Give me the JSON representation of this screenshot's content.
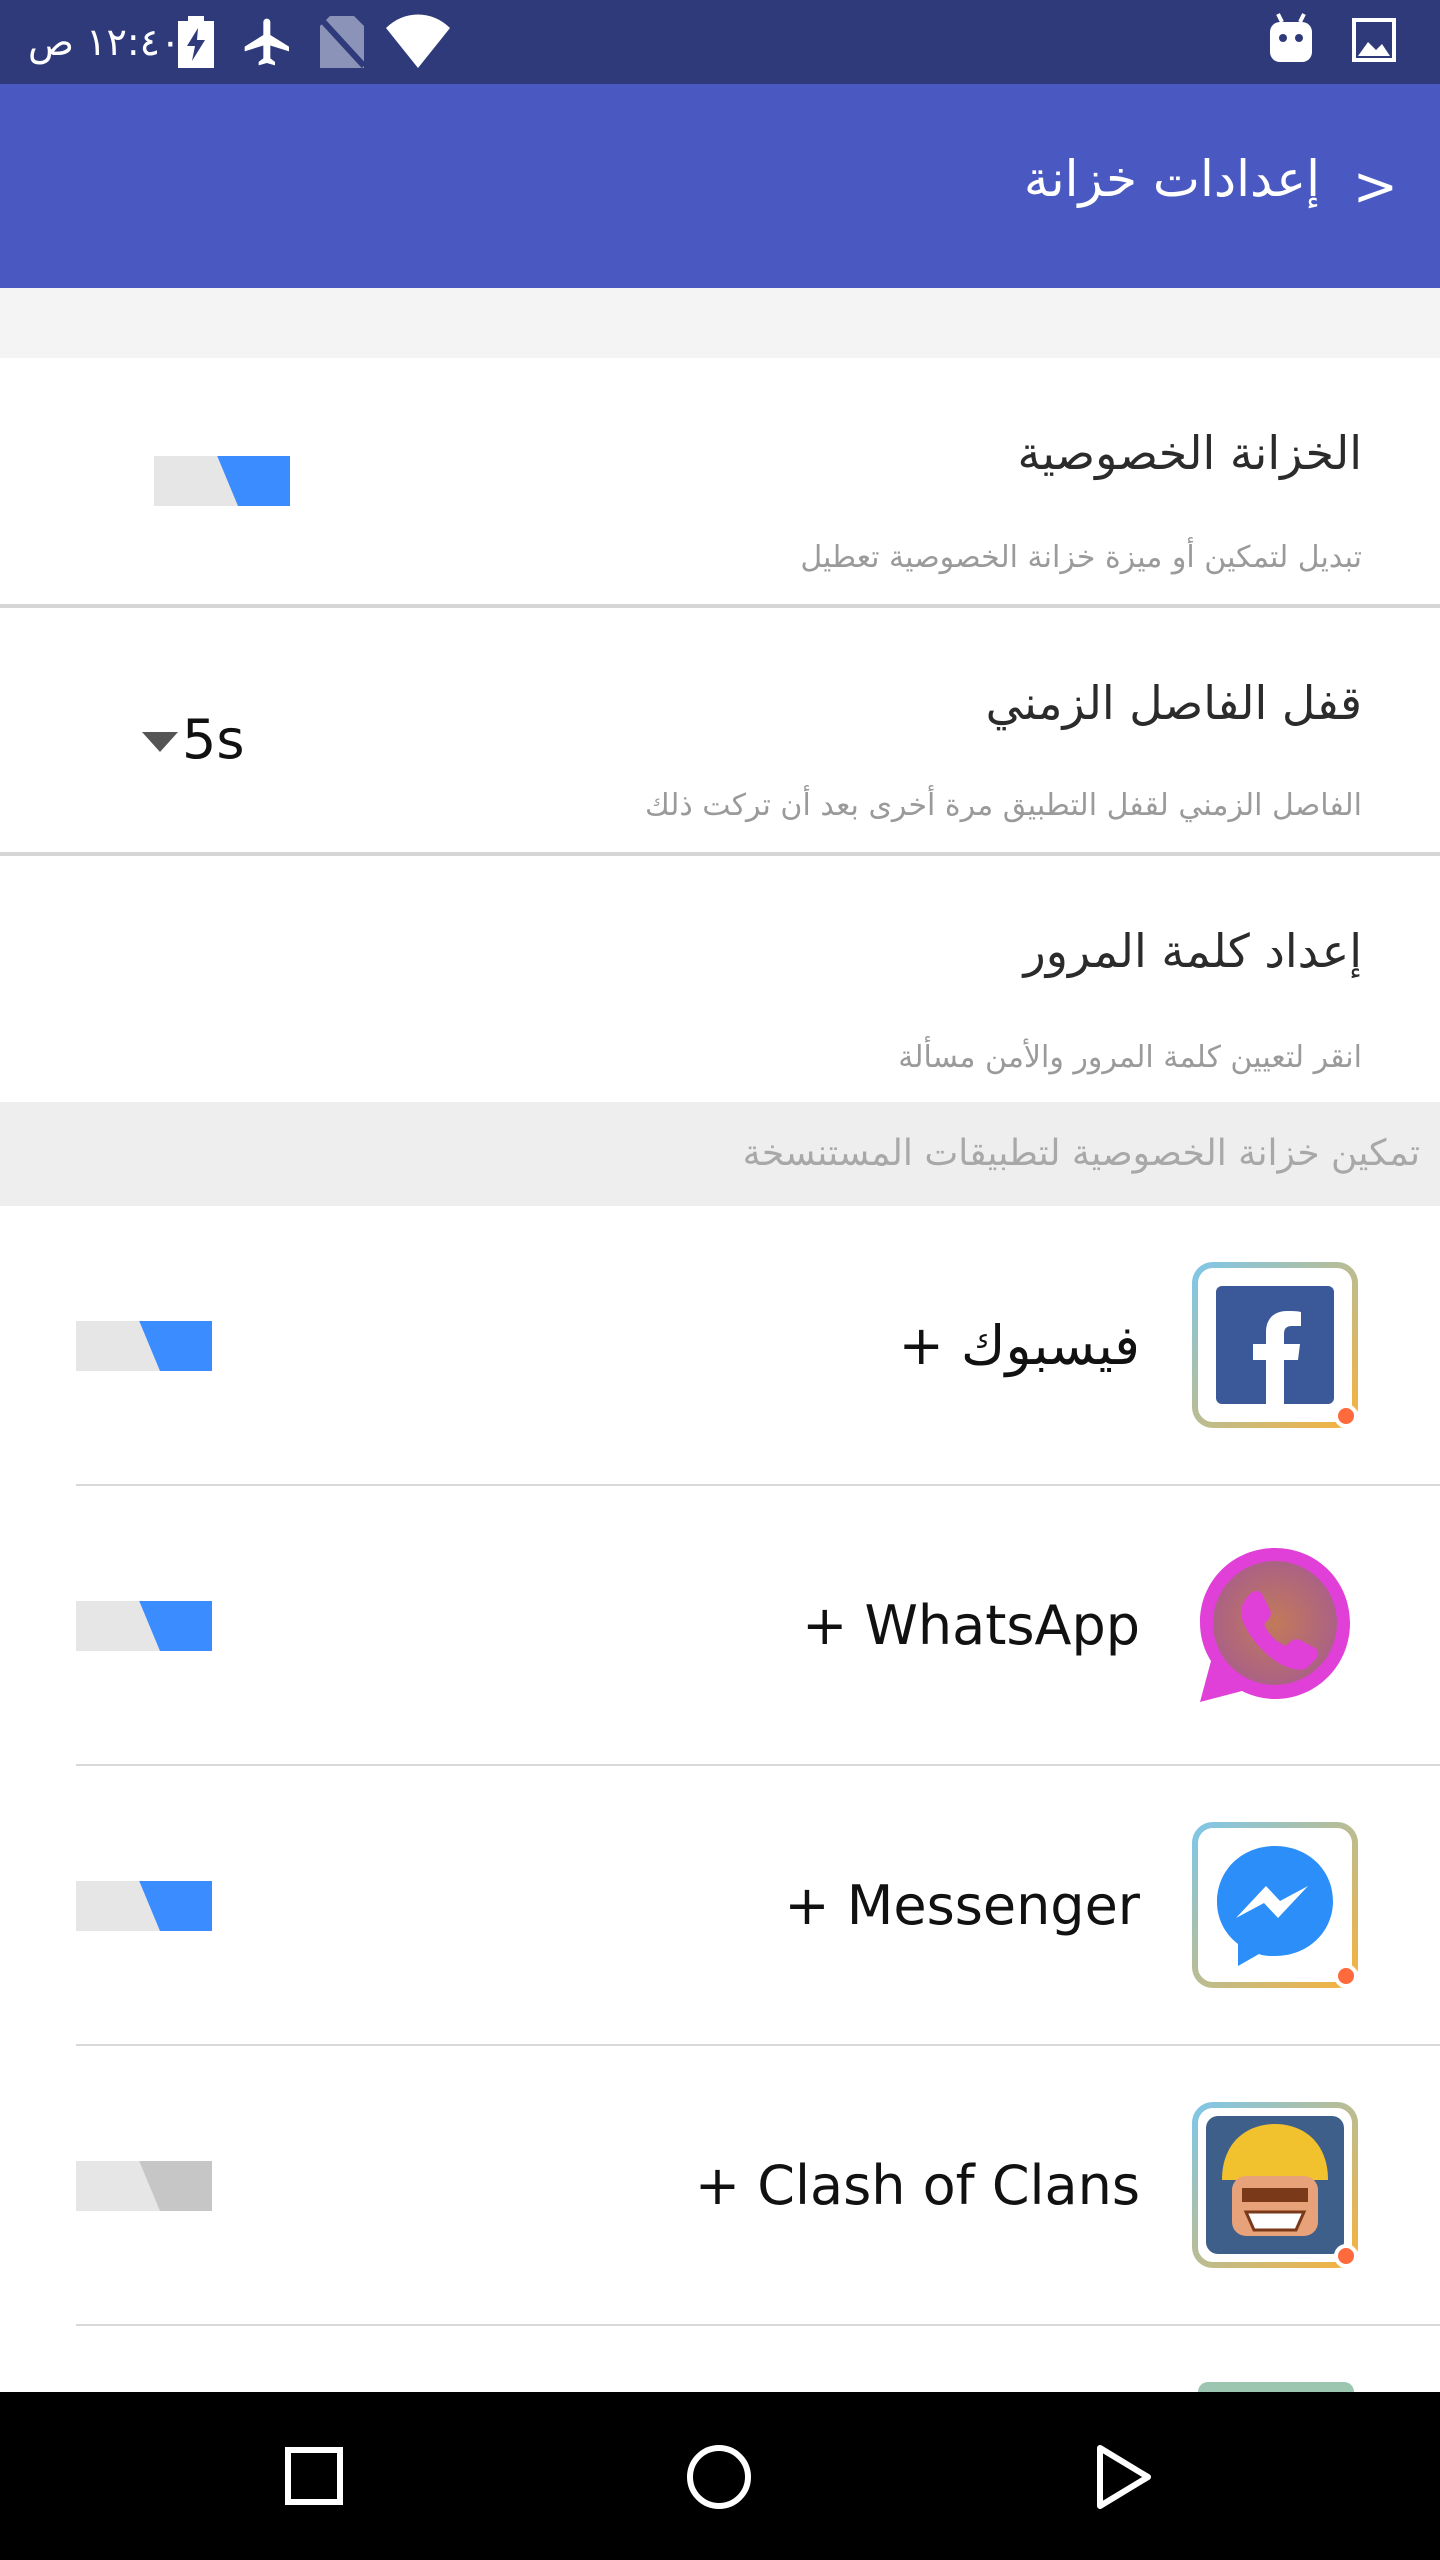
{
  "status_bar": {
    "time": "١٢:٤٠ ص"
  },
  "app_bar": {
    "title": "إعدادات خزانة",
    "back_glyph": ">"
  },
  "settings": [
    {
      "title": "الخزانة الخصوصية",
      "subtitle": "تبديل لتمكين أو ميزة خزانة الخصوصية تعطيل",
      "control": "toggle",
      "enabled": true
    },
    {
      "title": "قفل الفاصل الزمني",
      "subtitle": "الفاصل الزمني لقفل التطبيق مرة أخرى بعد أن تركت ذلك",
      "control": "dropdown",
      "value": "5s"
    },
    {
      "title": "إعداد كلمة المرور",
      "subtitle": "انقر لتعيين كلمة المرور والأمن مسألة"
    }
  ],
  "apps_section_header": "تمكين خزانة الخصوصية لتطبيقات المستنسخة",
  "apps": [
    {
      "name": "فيسبوك +",
      "icon": "facebook-icon",
      "enabled": true
    },
    {
      "name": "WhatsApp +",
      "icon": "whatsapp-icon",
      "enabled": true
    },
    {
      "name": "Messenger +",
      "icon": "messenger-icon",
      "enabled": true
    },
    {
      "name": "Clash of Clans +",
      "icon": "clash-of-clans-icon",
      "enabled": false
    }
  ],
  "colors": {
    "status_bar": "#2e3a7a",
    "app_bar": "#4a59c2",
    "toggle_on": "#3b8cff",
    "toggle_off": "#c6c6c6"
  }
}
